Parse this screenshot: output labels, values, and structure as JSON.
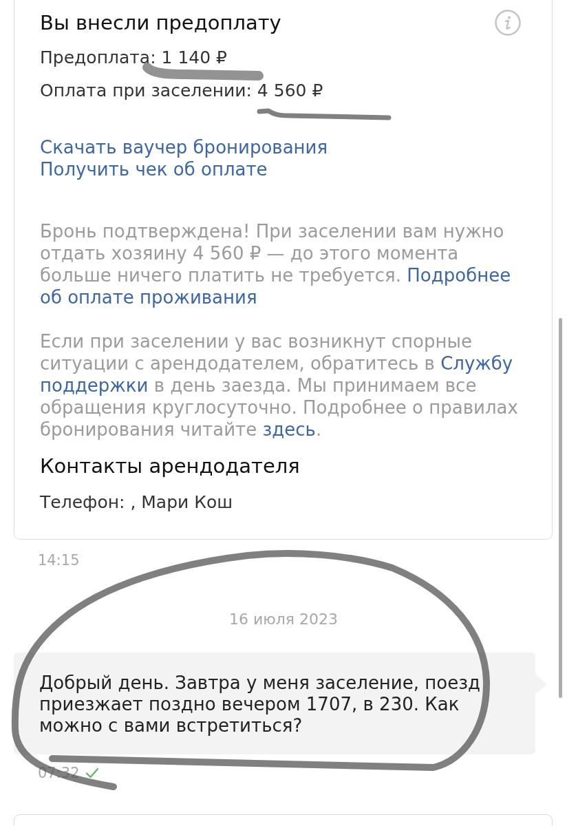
{
  "booking_card": {
    "title": "Вы внесли предоплату",
    "amounts": [
      "Предоплата: 1 140 ₽",
      "Оплата при заселении: 4 560 ₽"
    ],
    "links": [
      "Скачать ваучер бронирования",
      "Получить чек об оплате"
    ],
    "paragraphs": [
      {
        "lines": [
          [
            {
              "kind": "text",
              "text": "Бронь подтверждена! При заселении вам нужно"
            }
          ],
          [
            {
              "kind": "text",
              "text": "отдать хозяину 4 560 ₽ — до этого момента"
            }
          ],
          [
            {
              "kind": "text",
              "text": "больше ничего платить не требуется. "
            },
            {
              "kind": "link",
              "text": "Подробнее"
            }
          ],
          [
            {
              "kind": "link",
              "text": "об оплате проживания"
            }
          ]
        ]
      },
      {
        "lines": [
          [
            {
              "kind": "text",
              "text": "Если при заселении у вас возникнут спорные"
            }
          ],
          [
            {
              "kind": "text",
              "text": "ситуации с арендодателем, обратитесь в "
            },
            {
              "kind": "link",
              "text": "Службу"
            }
          ],
          [
            {
              "kind": "link",
              "text": "поддержки"
            },
            {
              "kind": "text",
              "text": " в день заезда. Мы принимаем все"
            }
          ],
          [
            {
              "kind": "text",
              "text": "обращения круглосуточно. Подробнее о правилах"
            }
          ],
          [
            {
              "kind": "text",
              "text": "бронирования читайте "
            },
            {
              "kind": "link",
              "text": "здесь"
            },
            {
              "kind": "text",
              "text": "."
            }
          ]
        ]
      }
    ],
    "contacts": {
      "title": "Контакты арендодателя",
      "phone": "Телефон: , Мари Кош"
    }
  },
  "card_time": "14:15",
  "date_separator": "16 июля 2023",
  "messages": [
    {
      "text": "Добрый день. Завтра у меня заселение, поезд приезжает поздно вечером 1707, в 230. Как можно с вами встретиться?",
      "time": "07:32",
      "read": true
    }
  ]
}
